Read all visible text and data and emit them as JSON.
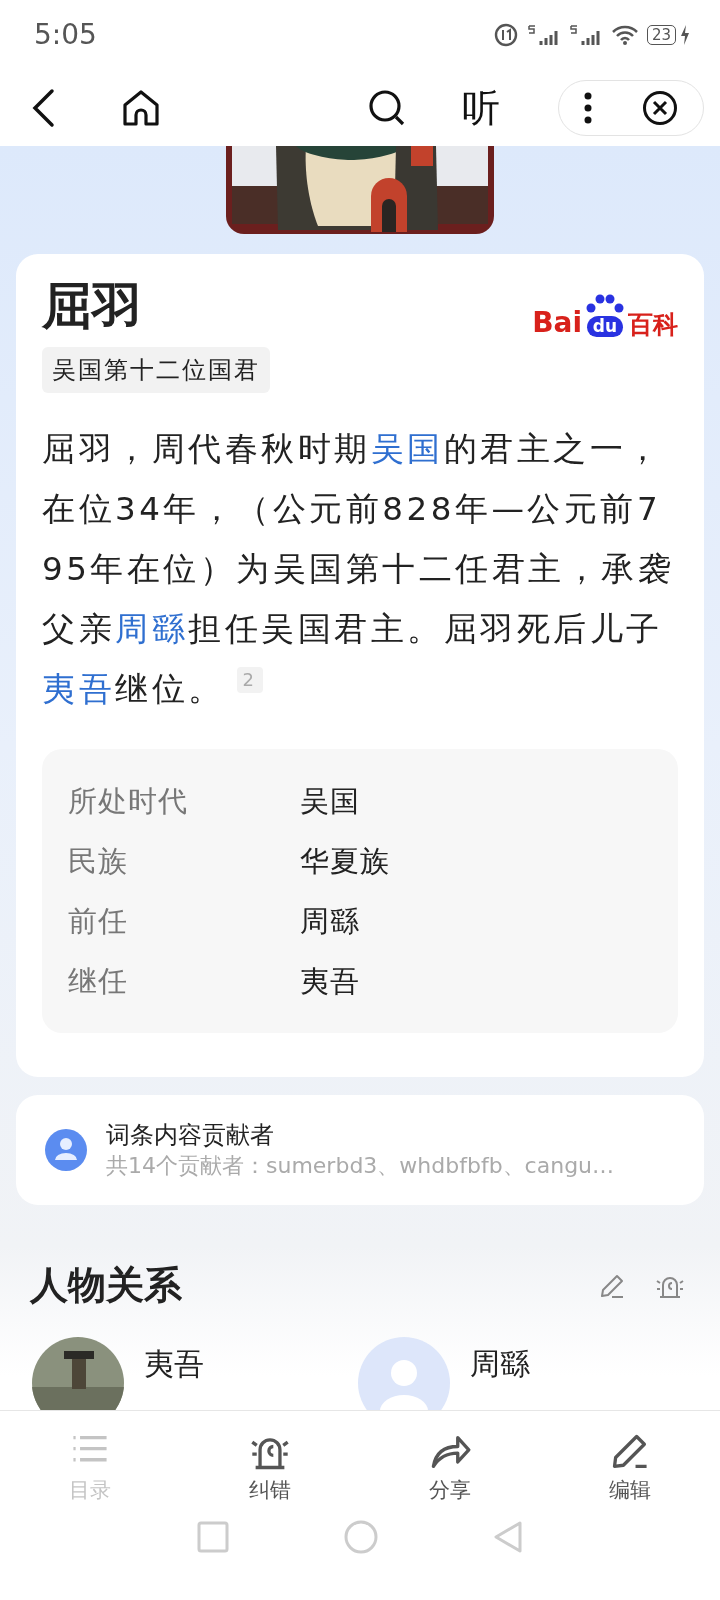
{
  "status_bar": {
    "time": "5:05",
    "battery": "23"
  },
  "toolbar": {
    "listen": "听"
  },
  "logo": {
    "left": "Bai",
    "mid": "du",
    "right": "百科"
  },
  "entry": {
    "title": "屈羽",
    "tag": "吴国第十二位国君",
    "summary": [
      {
        "kind": "text",
        "text": "屈羽，周代春秋时期"
      },
      {
        "kind": "link",
        "text": "吴国"
      },
      {
        "kind": "text",
        "text": "的君主之一，在位34年，（公元前828年—公元前795年在位）为吴国第十二任君主，承袭父亲"
      },
      {
        "kind": "link",
        "text": "周繇"
      },
      {
        "kind": "text",
        "text": "担任吴国君主。屈羽死后儿子"
      },
      {
        "kind": "link",
        "text": "夷吾"
      },
      {
        "kind": "text",
        "text": "继位。"
      },
      {
        "kind": "ref",
        "text": "2"
      }
    ],
    "infobox": [
      {
        "label": "所处时代",
        "value": "吴国"
      },
      {
        "label": "民族",
        "value": "华夏族"
      },
      {
        "label": "前任",
        "value": "周繇"
      },
      {
        "label": "继任",
        "value": "夷吾"
      }
    ]
  },
  "contributors": {
    "title": "词条内容贡献者",
    "detail": "共14个贡献者：sumerbd3、whdbfbfb、cangu…"
  },
  "relations": {
    "title": "人物关系",
    "people": [
      {
        "name": "夷吾",
        "kind": "picture"
      },
      {
        "name": "周繇",
        "kind": "placeholder"
      }
    ]
  },
  "bottom_bar": [
    {
      "label": "目录",
      "kind": "list",
      "disabled": true
    },
    {
      "label": "纠错",
      "kind": "alarm",
      "disabled": false
    },
    {
      "label": "分享",
      "kind": "share",
      "disabled": false
    },
    {
      "label": "编辑",
      "kind": "edit",
      "disabled": false
    }
  ]
}
